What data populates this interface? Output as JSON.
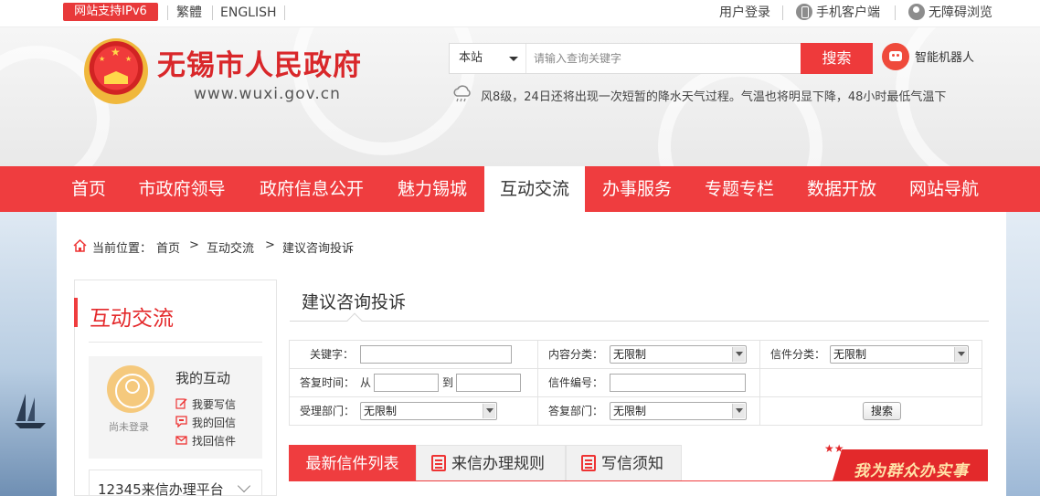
{
  "topbar": {
    "ipv6_badge": "网站支持IPv6",
    "traditional": "繁體",
    "english": "ENGLISH",
    "login": "用户登录",
    "mobile_client": "手机客户端",
    "accessible_browse": "无障碍浏览"
  },
  "header": {
    "site_title": "无锡市人民政府",
    "site_url": "www.wuxi.gov.cn",
    "search": {
      "scope": "本站",
      "placeholder": "请输入查询关键字",
      "button": "搜索"
    },
    "robot": "智能机器人",
    "weather": "风8级，24日还将出现一次短暂的降水天气过程。气温也将明显下降，48小时最低气温下"
  },
  "nav": {
    "items": [
      "首页",
      "市政府领导",
      "政府信息公开",
      "魅力锡城",
      "互动交流",
      "办事服务",
      "专题专栏",
      "数据开放",
      "网站导航"
    ],
    "active": "互动交流"
  },
  "breadcrumb": {
    "prefix": "当前位置：",
    "home": "首页",
    "sep1": ">",
    "section": "互动交流",
    "sep2": ">",
    "current": "建议咨询投诉"
  },
  "sidebar": {
    "title": "互动交流",
    "user": {
      "status": "尚未登录",
      "heading": "我的互动",
      "links": [
        "我要写信",
        "我的回信",
        "找回信件"
      ]
    },
    "hotline": "12345来信办理平台"
  },
  "main": {
    "title": "建议咨询投诉",
    "form": {
      "keyword_label": "关键字：",
      "content_type_label": "内容分类：",
      "content_type_value": "无限制",
      "letter_type_label": "信件分类：",
      "letter_type_value": "无限制",
      "reply_time_label": "答复时间：",
      "from": "从",
      "to": "到",
      "letter_no_label": "信件编号：",
      "accept_dept_label": "受理部门：",
      "accept_dept_value": "无限制",
      "reply_dept_label": "答复部门：",
      "reply_dept_value": "无限制",
      "search_button": "搜索"
    },
    "tabs": [
      "最新信件列表",
      "来信办理规则",
      "写信须知"
    ],
    "banner": "我为群众办实事"
  }
}
